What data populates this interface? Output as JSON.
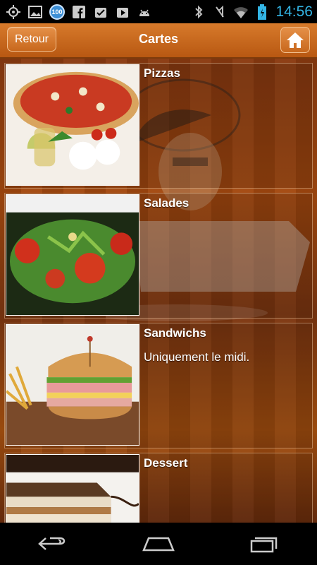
{
  "status_bar": {
    "time": "14:56",
    "notification_badge": "100",
    "icons": [
      "gps-icon",
      "image-icon",
      "badge-100-icon",
      "facebook-icon",
      "checkbox-icon",
      "play-store-icon",
      "android-icon",
      "bluetooth-icon",
      "mute-icon",
      "wifi-icon",
      "battery-icon"
    ]
  },
  "action_bar": {
    "back_label": "Retour",
    "title": "Cartes",
    "home_icon": "home-icon"
  },
  "menu": {
    "items": [
      {
        "title": "Pizzas",
        "description": ""
      },
      {
        "title": "Salades",
        "description": ""
      },
      {
        "title": "Sandwichs",
        "description": "Uniquement le midi."
      },
      {
        "title": "Dessert",
        "description": ""
      }
    ]
  },
  "colors": {
    "accent": "#33b5e5",
    "brand_orange": "#c8681d"
  },
  "nav_bar": {
    "icons": [
      "back-icon",
      "home-nav-icon",
      "recent-apps-icon"
    ]
  }
}
